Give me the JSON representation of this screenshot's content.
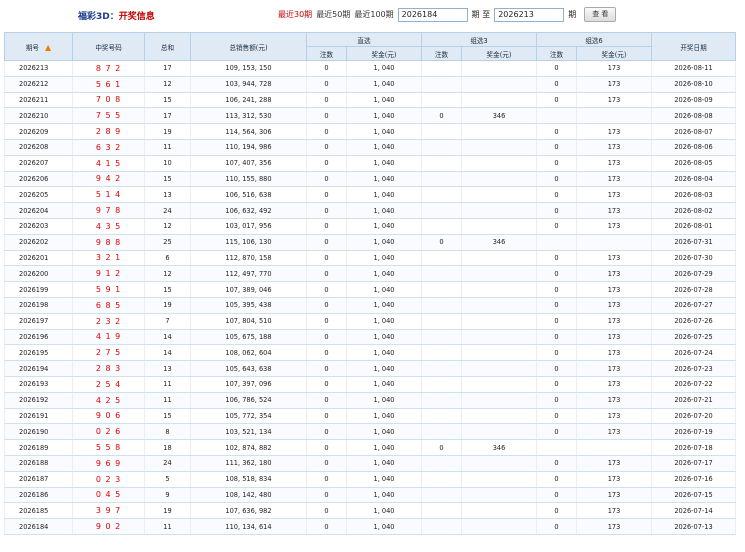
{
  "header": {
    "title_prefix": "福彩3D：",
    "title_suffix": "开奖信息",
    "quick_links": [
      "最近30期",
      "最近50期",
      "最近100期"
    ],
    "from_value": "2026184",
    "to_label": "期 至",
    "to_value": "2026213",
    "period_label": "期",
    "query_button": "查 看"
  },
  "table": {
    "headers": {
      "issue": "期号",
      "numbers": "中奖号码",
      "sum": "总和",
      "sales": "总销售额(元)",
      "direct": "直选",
      "group3": "组选3",
      "group6": "组选6",
      "count": "注数",
      "prize": "奖金(元)",
      "date": "开奖日期"
    },
    "rows": [
      {
        "issue": "2026213",
        "numbers": "8 7 2",
        "sum": "17",
        "sales": "109, 153, 150",
        "d_count": "0",
        "d_prize": "1, 040",
        "g3_count": "",
        "g3_prize": "",
        "g6_count": "0",
        "g6_prize": "173",
        "date": "2026-08-11"
      },
      {
        "issue": "2026212",
        "numbers": "5 6 1",
        "sum": "12",
        "sales": "103, 944, 728",
        "d_count": "0",
        "d_prize": "1, 040",
        "g3_count": "",
        "g3_prize": "",
        "g6_count": "0",
        "g6_prize": "173",
        "date": "2026-08-10"
      },
      {
        "issue": "2026211",
        "numbers": "7 0 8",
        "sum": "15",
        "sales": "106, 241, 288",
        "d_count": "0",
        "d_prize": "1, 040",
        "g3_count": "",
        "g3_prize": "",
        "g6_count": "0",
        "g6_prize": "173",
        "date": "2026-08-09"
      },
      {
        "issue": "2026210",
        "numbers": "7 5 5",
        "sum": "17",
        "sales": "113, 312, 530",
        "d_count": "0",
        "d_prize": "1, 040",
        "g3_count": "0",
        "g3_prize": "346",
        "g6_count": "",
        "g6_prize": "",
        "date": "2026-08-08"
      },
      {
        "issue": "2026209",
        "numbers": "2 8 9",
        "sum": "19",
        "sales": "114, 564, 306",
        "d_count": "0",
        "d_prize": "1, 040",
        "g3_count": "",
        "g3_prize": "",
        "g6_count": "0",
        "g6_prize": "173",
        "date": "2026-08-07"
      },
      {
        "issue": "2026208",
        "numbers": "6 3 2",
        "sum": "11",
        "sales": "110, 194, 986",
        "d_count": "0",
        "d_prize": "1, 040",
        "g3_count": "",
        "g3_prize": "",
        "g6_count": "0",
        "g6_prize": "173",
        "date": "2026-08-06"
      },
      {
        "issue": "2026207",
        "numbers": "4 1 5",
        "sum": "10",
        "sales": "107, 407, 356",
        "d_count": "0",
        "d_prize": "1, 040",
        "g3_count": "",
        "g3_prize": "",
        "g6_count": "0",
        "g6_prize": "173",
        "date": "2026-08-05"
      },
      {
        "issue": "2026206",
        "numbers": "9 4 2",
        "sum": "15",
        "sales": "110, 155, 880",
        "d_count": "0",
        "d_prize": "1, 040",
        "g3_count": "",
        "g3_prize": "",
        "g6_count": "0",
        "g6_prize": "173",
        "date": "2026-08-04"
      },
      {
        "issue": "2026205",
        "numbers": "5 1 4",
        "sum": "13",
        "sales": "106, 516, 638",
        "d_count": "0",
        "d_prize": "1, 040",
        "g3_count": "",
        "g3_prize": "",
        "g6_count": "0",
        "g6_prize": "173",
        "date": "2026-08-03"
      },
      {
        "issue": "2026204",
        "numbers": "9 7 8",
        "sum": "24",
        "sales": "106, 632, 492",
        "d_count": "0",
        "d_prize": "1, 040",
        "g3_count": "",
        "g3_prize": "",
        "g6_count": "0",
        "g6_prize": "173",
        "date": "2026-08-02"
      },
      {
        "issue": "2026203",
        "numbers": "4 3 5",
        "sum": "12",
        "sales": "103, 017, 956",
        "d_count": "0",
        "d_prize": "1, 040",
        "g3_count": "",
        "g3_prize": "",
        "g6_count": "0",
        "g6_prize": "173",
        "date": "2026-08-01"
      },
      {
        "issue": "2026202",
        "numbers": "9 8 8",
        "sum": "25",
        "sales": "115, 106, 130",
        "d_count": "0",
        "d_prize": "1, 040",
        "g3_count": "0",
        "g3_prize": "346",
        "g6_count": "",
        "g6_prize": "",
        "date": "2026-07-31"
      },
      {
        "issue": "2026201",
        "numbers": "3 2 1",
        "sum": "6",
        "sales": "112, 870, 158",
        "d_count": "0",
        "d_prize": "1, 040",
        "g3_count": "",
        "g3_prize": "",
        "g6_count": "0",
        "g6_prize": "173",
        "date": "2026-07-30"
      },
      {
        "issue": "2026200",
        "numbers": "9 1 2",
        "sum": "12",
        "sales": "112, 497, 770",
        "d_count": "0",
        "d_prize": "1, 040",
        "g3_count": "",
        "g3_prize": "",
        "g6_count": "0",
        "g6_prize": "173",
        "date": "2026-07-29"
      },
      {
        "issue": "2026199",
        "numbers": "5 9 1",
        "sum": "15",
        "sales": "107, 389, 046",
        "d_count": "0",
        "d_prize": "1, 040",
        "g3_count": "",
        "g3_prize": "",
        "g6_count": "0",
        "g6_prize": "173",
        "date": "2026-07-28"
      },
      {
        "issue": "2026198",
        "numbers": "6 8 5",
        "sum": "19",
        "sales": "105, 395, 438",
        "d_count": "0",
        "d_prize": "1, 040",
        "g3_count": "",
        "g3_prize": "",
        "g6_count": "0",
        "g6_prize": "173",
        "date": "2026-07-27"
      },
      {
        "issue": "2026197",
        "numbers": "2 3 2",
        "sum": "7",
        "sales": "107, 804, 510",
        "d_count": "0",
        "d_prize": "1, 040",
        "g3_count": "",
        "g3_prize": "",
        "g6_count": "0",
        "g6_prize": "173",
        "date": "2026-07-26"
      },
      {
        "issue": "2026196",
        "numbers": "4 1 9",
        "sum": "14",
        "sales": "105, 675, 188",
        "d_count": "0",
        "d_prize": "1, 040",
        "g3_count": "",
        "g3_prize": "",
        "g6_count": "0",
        "g6_prize": "173",
        "date": "2026-07-25"
      },
      {
        "issue": "2026195",
        "numbers": "2 7 5",
        "sum": "14",
        "sales": "108, 062, 604",
        "d_count": "0",
        "d_prize": "1, 040",
        "g3_count": "",
        "g3_prize": "",
        "g6_count": "0",
        "g6_prize": "173",
        "date": "2026-07-24"
      },
      {
        "issue": "2026194",
        "numbers": "2 8 3",
        "sum": "13",
        "sales": "105, 643, 638",
        "d_count": "0",
        "d_prize": "1, 040",
        "g3_count": "",
        "g3_prize": "",
        "g6_count": "0",
        "g6_prize": "173",
        "date": "2026-07-23"
      },
      {
        "issue": "2026193",
        "numbers": "2 5 4",
        "sum": "11",
        "sales": "107, 397, 096",
        "d_count": "0",
        "d_prize": "1, 040",
        "g3_count": "",
        "g3_prize": "",
        "g6_count": "0",
        "g6_prize": "173",
        "date": "2026-07-22"
      },
      {
        "issue": "2026192",
        "numbers": "4 2 5",
        "sum": "11",
        "sales": "106, 786, 524",
        "d_count": "0",
        "d_prize": "1, 040",
        "g3_count": "",
        "g3_prize": "",
        "g6_count": "0",
        "g6_prize": "173",
        "date": "2026-07-21"
      },
      {
        "issue": "2026191",
        "numbers": "9 0 6",
        "sum": "15",
        "sales": "105, 772, 354",
        "d_count": "0",
        "d_prize": "1, 040",
        "g3_count": "",
        "g3_prize": "",
        "g6_count": "0",
        "g6_prize": "173",
        "date": "2026-07-20"
      },
      {
        "issue": "2026190",
        "numbers": "0 2 6",
        "sum": "8",
        "sales": "103, 521, 134",
        "d_count": "0",
        "d_prize": "1, 040",
        "g3_count": "",
        "g3_prize": "",
        "g6_count": "0",
        "g6_prize": "173",
        "date": "2026-07-19"
      },
      {
        "issue": "2026189",
        "numbers": "5 5 8",
        "sum": "18",
        "sales": "102, 874, 882",
        "d_count": "0",
        "d_prize": "1, 040",
        "g3_count": "0",
        "g3_prize": "346",
        "g6_count": "",
        "g6_prize": "",
        "date": "2026-07-18"
      },
      {
        "issue": "2026188",
        "numbers": "9 6 9",
        "sum": "24",
        "sales": "111, 362, 180",
        "d_count": "0",
        "d_prize": "1, 040",
        "g3_count": "",
        "g3_prize": "",
        "g6_count": "0",
        "g6_prize": "173",
        "date": "2026-07-17"
      },
      {
        "issue": "2026187",
        "numbers": "0 2 3",
        "sum": "5",
        "sales": "108, 518, 834",
        "d_count": "0",
        "d_prize": "1, 040",
        "g3_count": "",
        "g3_prize": "",
        "g6_count": "0",
        "g6_prize": "173",
        "date": "2026-07-16"
      },
      {
        "issue": "2026186",
        "numbers": "0 4 5",
        "sum": "9",
        "sales": "108, 142, 480",
        "d_count": "0",
        "d_prize": "1, 040",
        "g3_count": "",
        "g3_prize": "",
        "g6_count": "0",
        "g6_prize": "173",
        "date": "2026-07-15"
      },
      {
        "issue": "2026185",
        "numbers": "3 9 7",
        "sum": "19",
        "sales": "107, 636, 982",
        "d_count": "0",
        "d_prize": "1, 040",
        "g3_count": "",
        "g3_prize": "",
        "g6_count": "0",
        "g6_prize": "173",
        "date": "2026-07-14"
      },
      {
        "issue": "2026184",
        "numbers": "9 0 2",
        "sum": "11",
        "sales": "110, 134, 614",
        "d_count": "0",
        "d_prize": "1, 040",
        "g3_count": "",
        "g3_prize": "",
        "g6_count": "0",
        "g6_prize": "173",
        "date": "2026-07-13"
      }
    ]
  }
}
